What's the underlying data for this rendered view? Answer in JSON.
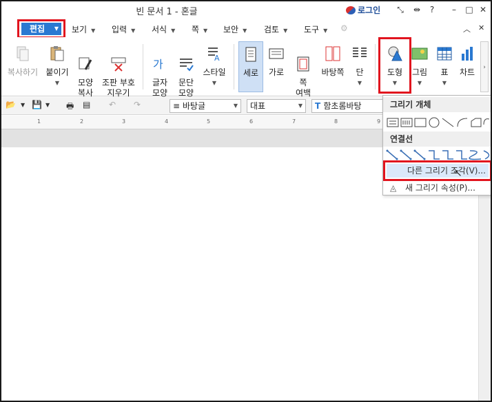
{
  "window": {
    "title": "빈 문서 1 - 혼글",
    "login": "로그인",
    "icons": [
      "login-icon",
      "fullscreen-icon",
      "resize-icon",
      "help-icon",
      "minimize-icon",
      "maximize-icon",
      "close-icon"
    ]
  },
  "menu": {
    "items": [
      "편집",
      "보기",
      "입력",
      "서식",
      "쪽",
      "보안",
      "검토",
      "도구"
    ]
  },
  "ribbon": {
    "copy": "복사하기",
    "paste": "붙이기",
    "format_copy": "모양\n복사",
    "clear_format": "조판 부호\n지우기",
    "char_format": "글자\n모양",
    "para_format": "문단\n모양",
    "style": "스타일",
    "vertical": "세로",
    "horizontal": "가로",
    "page_margin": "쪽\n여백",
    "background_page": "바탕쪽",
    "column": "단",
    "shape": "도형",
    "picture": "그림",
    "table": "표",
    "chart": "차트"
  },
  "toolbar": {
    "style_combo": "바탕글",
    "heading_combo": "대표",
    "font_combo": "함초롬바탕"
  },
  "ruler": {
    "ticks": [
      "1",
      "2",
      "3",
      "4",
      "5",
      "6",
      "7",
      "8",
      "9"
    ]
  },
  "panel": {
    "section_drawing": "그리기 개체",
    "section_connector": "연결선",
    "item_other": "다른 그리기 조각(V)...",
    "item_new": "새 그리기 속성(P)..."
  },
  "colors": {
    "highlight_red": "#e1141e",
    "edit_blue": "#2a79d1",
    "selected_blue": "#cfe0f5"
  }
}
